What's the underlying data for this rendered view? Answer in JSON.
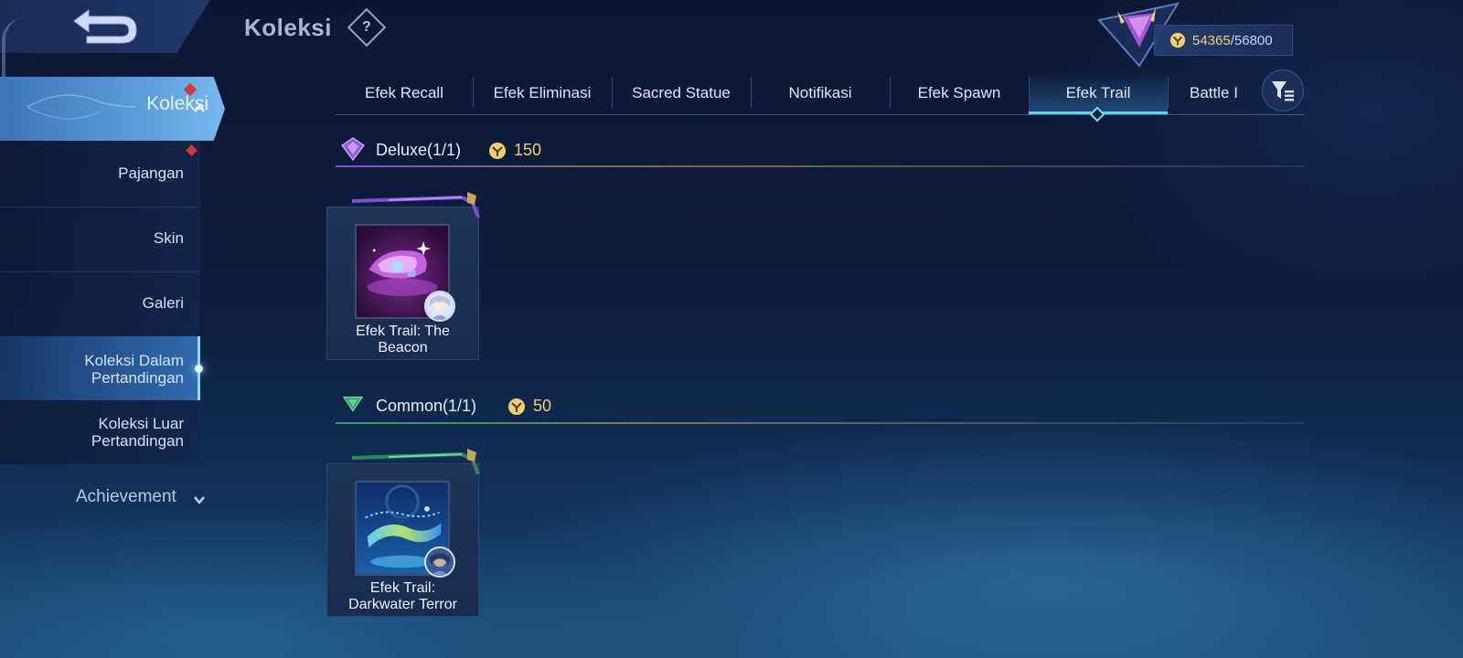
{
  "header": {
    "title": "Koleksi",
    "help_glyph": "?",
    "currency": {
      "current": "54365",
      "separator": "/",
      "max": "56800",
      "icon": "coin-icon"
    },
    "back_icon": "back-arrow-icon",
    "rank_icon": "rank-badge-icon"
  },
  "tabs": [
    {
      "label": "Efek Recall",
      "active": false
    },
    {
      "label": "Efek Eliminasi",
      "active": false
    },
    {
      "label": "Sacred Statue",
      "active": false
    },
    {
      "label": "Notifikasi",
      "active": false
    },
    {
      "label": "Efek Spawn",
      "active": false
    },
    {
      "label": "Efek Trail",
      "active": true
    },
    {
      "label": "Battle I",
      "active": false
    }
  ],
  "sidebar": {
    "main_label": "Koleksi",
    "items": [
      {
        "label": "Pajangan"
      },
      {
        "label": "Skin"
      },
      {
        "label": "Galeri"
      },
      {
        "label_line1": "Koleksi Dalam",
        "label_line2": "Pertandingan",
        "active": true
      },
      {
        "label_line1": "Koleksi Luar",
        "label_line2": "Pertandingan"
      }
    ],
    "achievement_label": "Achievement"
  },
  "sections": [
    {
      "title": "Deluxe(1/1)",
      "cost": "150",
      "color": "#8f5de0",
      "items": [
        {
          "name_line1": "Efek Trail: The",
          "name_line2": "Beacon"
        }
      ]
    },
    {
      "title": "Common(1/1)",
      "cost": "50",
      "color": "#2fae6a",
      "items": [
        {
          "name_line1": "Efek Trail:",
          "name_line2": "Darkwater Terror"
        }
      ]
    }
  ],
  "colors": {
    "accent": "#5fd3ee",
    "gold": "#f2cf72",
    "alert": "#d13a3a"
  }
}
